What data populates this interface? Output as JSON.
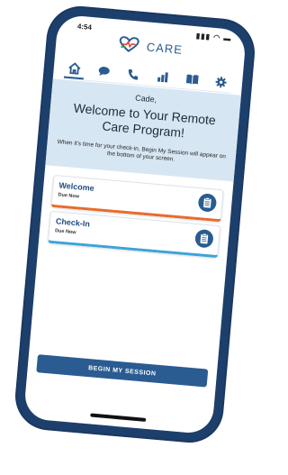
{
  "status": {
    "time": "4:54",
    "indicators": "▮▮▮ ◠ ▬"
  },
  "app": {
    "brand": "CARE",
    "brand_color": "#2a5c91",
    "accent_red": "#e0463a",
    "accent_green": "#2fa64a"
  },
  "tabs": [
    {
      "icon": "home-icon",
      "active": true
    },
    {
      "icon": "chat-icon",
      "active": false
    },
    {
      "icon": "phone-icon",
      "active": false
    },
    {
      "icon": "bar-chart-icon",
      "active": false
    },
    {
      "icon": "book-icon",
      "active": false
    },
    {
      "icon": "gear-icon",
      "active": false
    }
  ],
  "hero": {
    "name": "Cade,",
    "title": "Welcome to Your Remote Care Program!",
    "subtitle": "When it's time for your check-in, Begin My Session will appear on the bottom of your screen."
  },
  "tasks": [
    {
      "title": "Welcome",
      "due": "Due Now",
      "status_color": "#e86b2e",
      "icon": "clipboard-icon"
    },
    {
      "title": "Check-In",
      "due": "Due Now",
      "status_color": "#3aa4d9",
      "icon": "clipboard-icon"
    }
  ],
  "action": {
    "begin_label": "BEGIN MY SESSION"
  }
}
